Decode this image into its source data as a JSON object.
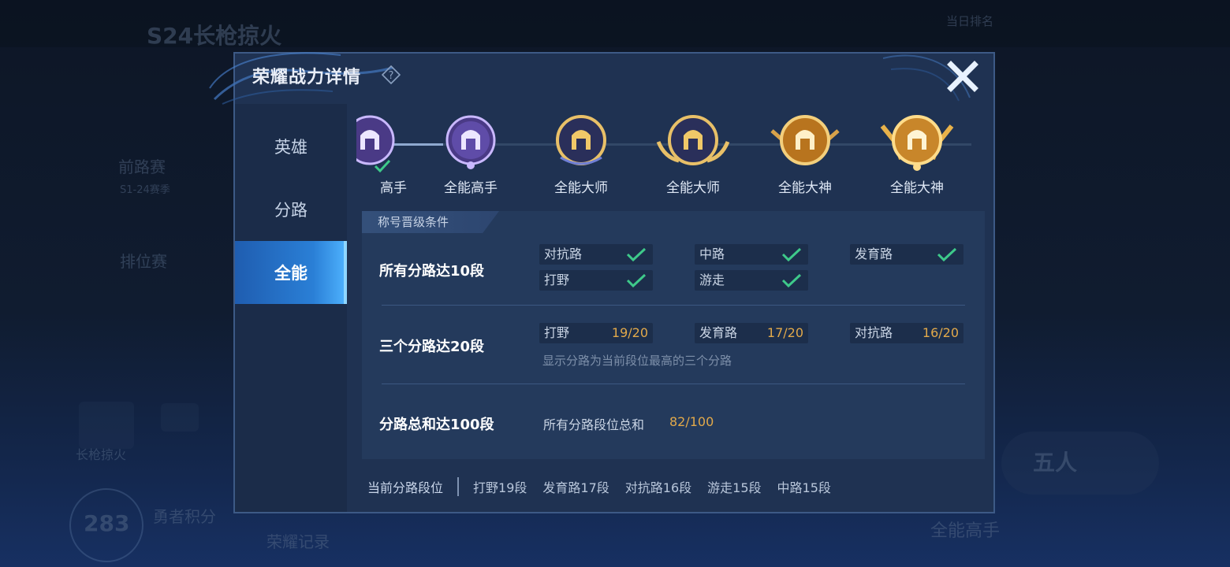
{
  "dialog": {
    "title": "荣耀战力详情",
    "help_icon": "question-diamond-icon",
    "close_icon": "close-x-icon"
  },
  "nav": {
    "items": [
      {
        "label": "英雄",
        "active": false
      },
      {
        "label": "分路",
        "active": false
      },
      {
        "label": "全能",
        "active": true
      }
    ]
  },
  "badges": [
    {
      "label": "高手",
      "tier": "purple",
      "achieved": true
    },
    {
      "label": "全能高手",
      "tier": "purple"
    },
    {
      "label": "全能大师",
      "tier": "gold-dark"
    },
    {
      "label": "全能大师",
      "tier": "gold-dark-wings"
    },
    {
      "label": "全能大神",
      "tier": "gold"
    },
    {
      "label": "全能大神",
      "tier": "gold-wings"
    }
  ],
  "conditions": {
    "tab_label": "称号晋级条件",
    "rows": [
      {
        "title": "所有分路达10段",
        "cells": [
          {
            "name": "对抗路",
            "done": true
          },
          {
            "name": "中路",
            "done": true
          },
          {
            "name": "发育路",
            "done": true
          },
          {
            "name": "打野",
            "done": true
          },
          {
            "name": "游走",
            "done": true
          }
        ]
      },
      {
        "title": "三个分路达20段",
        "cells": [
          {
            "name": "打野",
            "value": "19/20"
          },
          {
            "name": "发育路",
            "value": "17/20"
          },
          {
            "name": "对抗路",
            "value": "16/20"
          }
        ],
        "hint": "显示分路为当前段位最高的三个分路"
      },
      {
        "title": "分路总和达100段",
        "sum_label": "所有分路段位总和",
        "sum_value": "82/100"
      }
    ]
  },
  "footer": {
    "label": "当前分路段位",
    "segments": [
      "打野19段",
      "发育路17段",
      "对抗路16段",
      "游走15段",
      "中路15段"
    ]
  },
  "background": {
    "texts": [
      "S24长枪掠火",
      "前路赛",
      "S1-24赛季",
      "排位赛",
      "长枪掠火",
      "勇者积分",
      "荣耀记录",
      "五人",
      "全能高手",
      "283",
      "当日排名"
    ]
  },
  "colors": {
    "accent_blue": "#2a7fd6",
    "progress_gold": "#e2a94a",
    "check_green": "#3ec98a",
    "panel": "#243a5c"
  }
}
